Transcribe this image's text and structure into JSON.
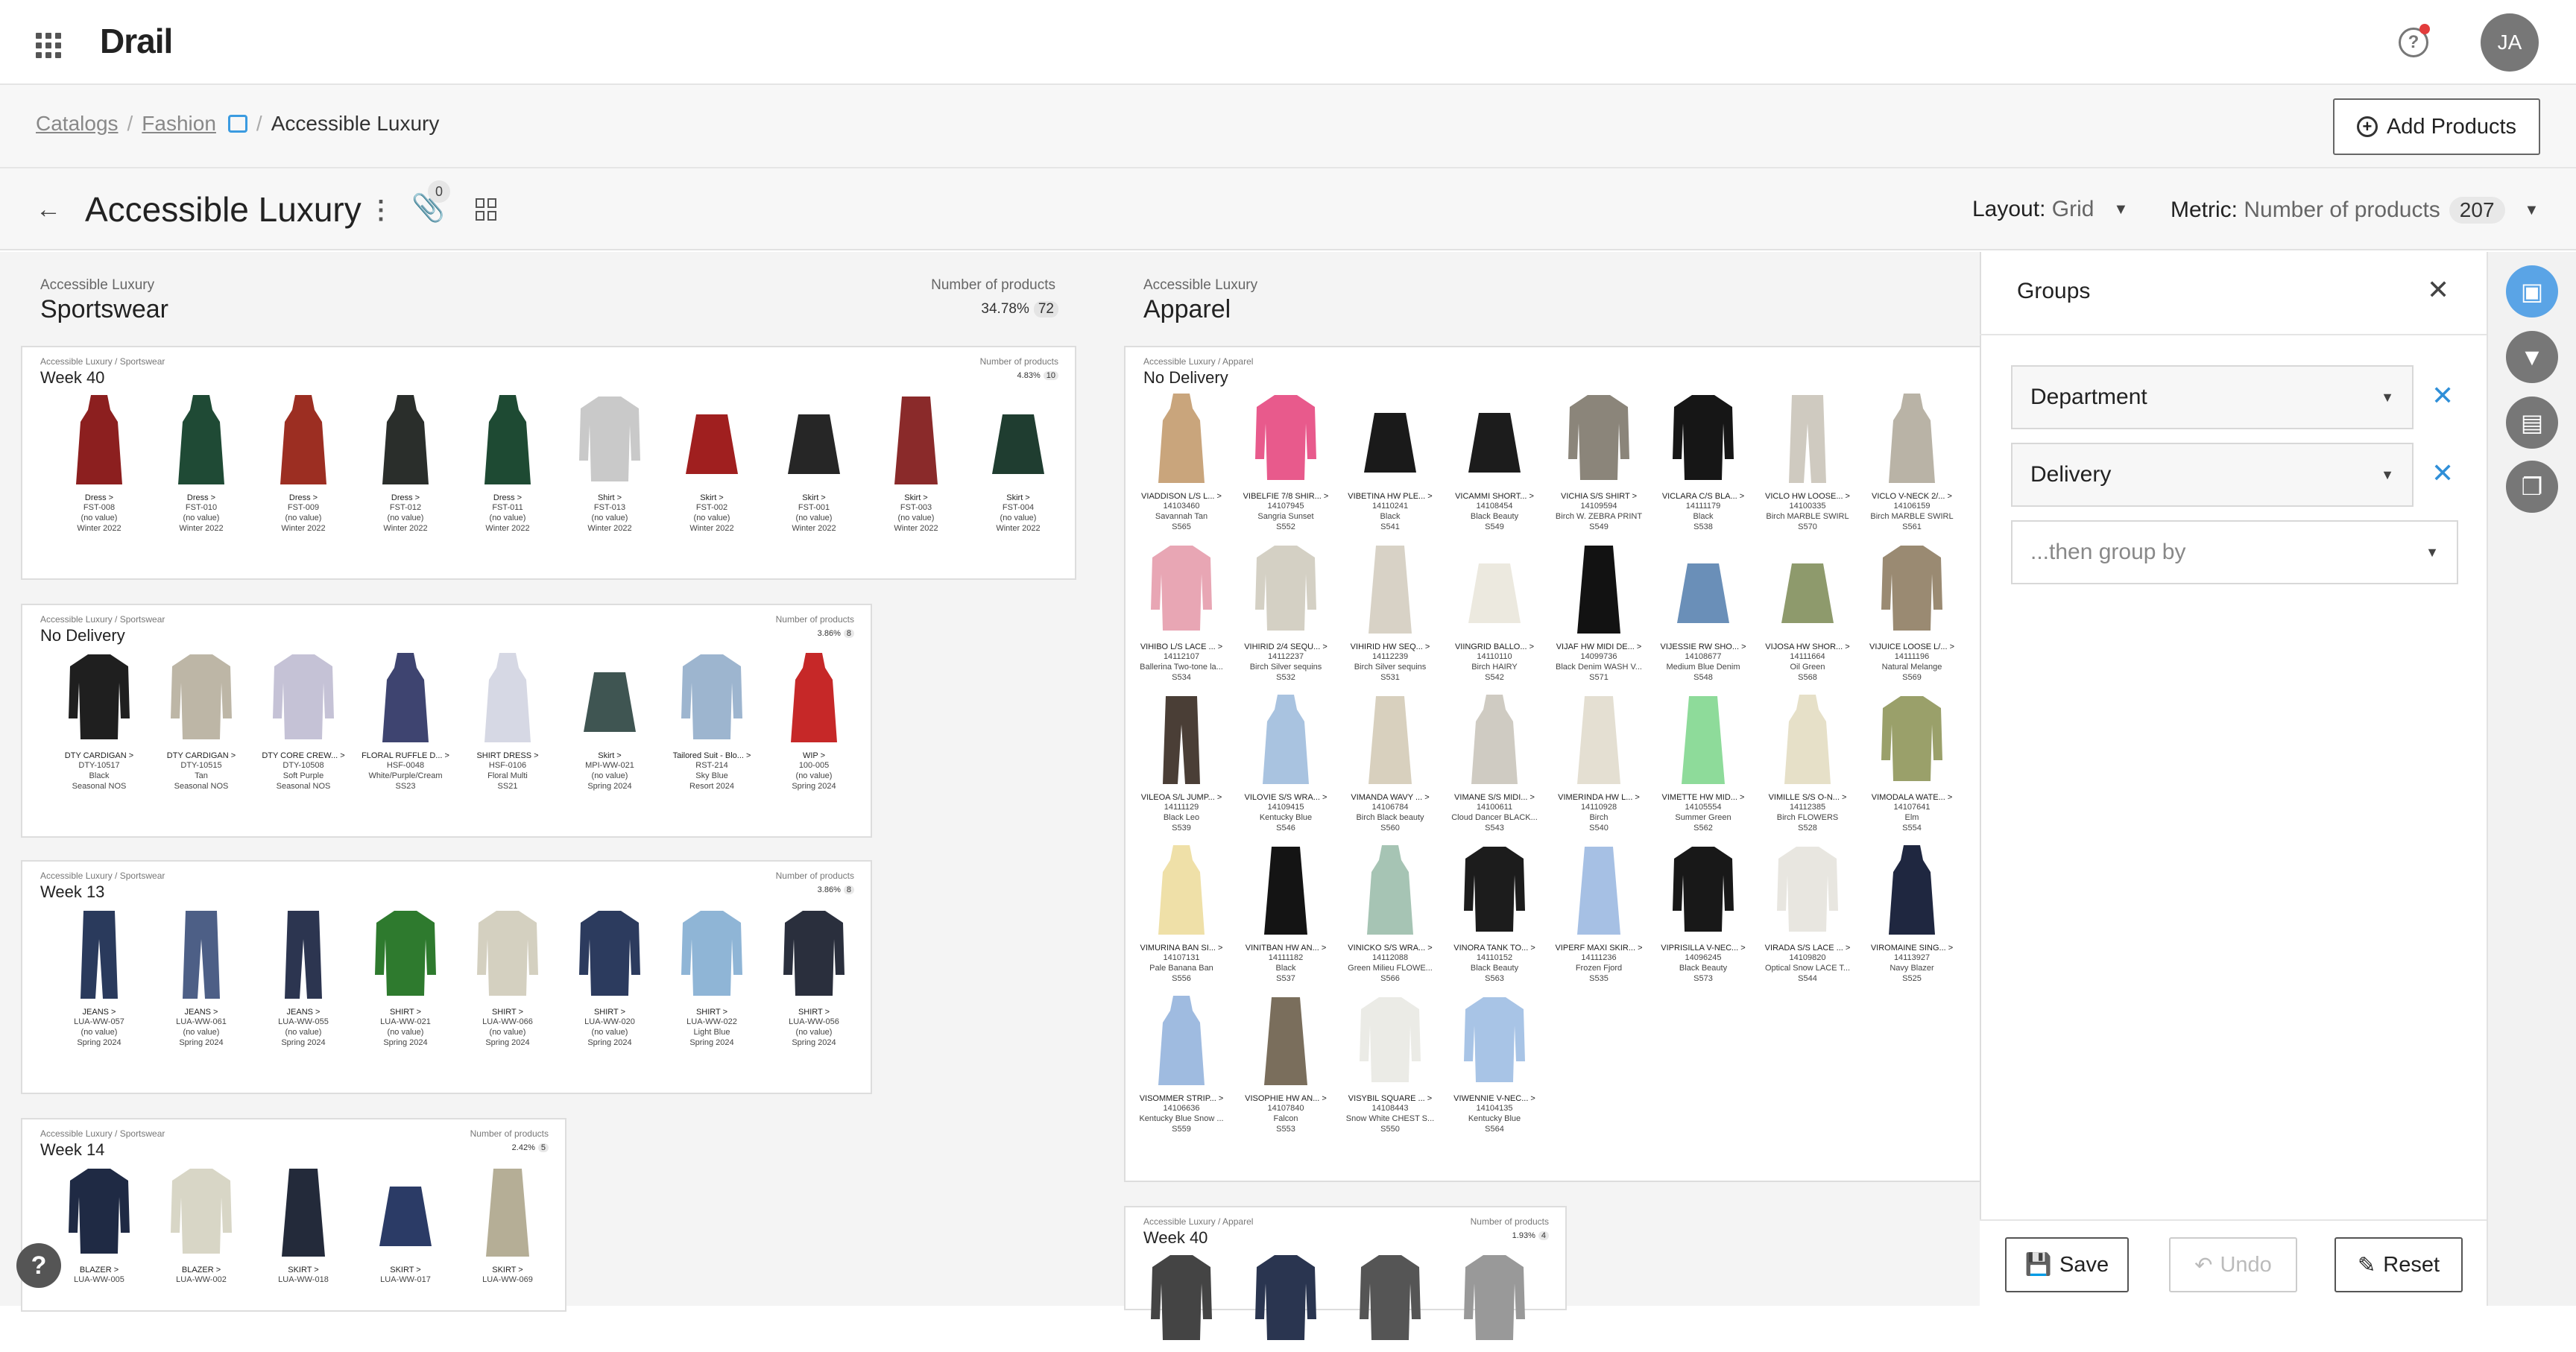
{
  "app": {
    "title": "Drail",
    "avatar": "JA",
    "help": "?"
  },
  "breadcrumb": {
    "items": [
      "Catalogs",
      "Fashion"
    ],
    "current": "Accessible Luxury",
    "sep": "/"
  },
  "header": {
    "add_products": "Add Products",
    "title": "Accessible Luxury",
    "clip_count": "0",
    "layout_label": "Layout:",
    "layout_value": "Grid",
    "metric_label": "Metric:",
    "metric_value": "Number of products",
    "metric_count": "207"
  },
  "sections": [
    {
      "sub": "Accessible Luxury",
      "title": "Sportswear",
      "metric_label": "Number of products",
      "pct": "34.78%",
      "count": "72"
    },
    {
      "sub": "Accessible Luxury",
      "title": "Apparel"
    }
  ],
  "cards": [
    {
      "sub": "Accessible Luxury / Sportswear",
      "title": "Week 40",
      "metric_label": "Number of products",
      "pct": "4.83%",
      "count": "10",
      "products": [
        {
          "name": "Dress >",
          "sku": "FST-008",
          "color": "(no value)",
          "season": "Winter 2022",
          "fill": "#8c1f1f",
          "shape": "dress"
        },
        {
          "name": "Dress >",
          "sku": "FST-010",
          "color": "(no value)",
          "season": "Winter 2022",
          "fill": "#1f4a35",
          "shape": "dress"
        },
        {
          "name": "Dress >",
          "sku": "FST-009",
          "color": "(no value)",
          "season": "Winter 2022",
          "fill": "#9c2e22",
          "shape": "dress"
        },
        {
          "name": "Dress >",
          "sku": "FST-012",
          "color": "(no value)",
          "season": "Winter 2022",
          "fill": "#2a2e2b",
          "shape": "dress"
        },
        {
          "name": "Dress >",
          "sku": "FST-011",
          "color": "(no value)",
          "season": "Winter 2022",
          "fill": "#1e4a33",
          "shape": "dress"
        },
        {
          "name": "Shirt >",
          "sku": "FST-013",
          "color": "(no value)",
          "season": "Winter 2022",
          "fill": "#c9c9c9",
          "shape": "top"
        },
        {
          "name": "Skirt >",
          "sku": "FST-002",
          "color": "(no value)",
          "season": "Winter 2022",
          "fill": "#a01f1f",
          "shape": "skirt"
        },
        {
          "name": "Skirt >",
          "sku": "FST-001",
          "color": "(no value)",
          "season": "Winter 2022",
          "fill": "#262626",
          "shape": "skirt"
        },
        {
          "name": "Skirt >",
          "sku": "FST-003",
          "color": "(no value)",
          "season": "Winter 2022",
          "fill": "#8a2a2a",
          "shape": "longskirt"
        },
        {
          "name": "Skirt >",
          "sku": "FST-004",
          "color": "(no value)",
          "season": "Winter 2022",
          "fill": "#1f3d30",
          "shape": "skirt"
        }
      ]
    },
    {
      "sub": "Accessible Luxury / Sportswear",
      "title": "No Delivery",
      "metric_label": "Number of products",
      "pct": "3.86%",
      "count": "8",
      "products": [
        {
          "name": "DTY CARDIGAN >",
          "sku": "DTY-10517",
          "color": "Black",
          "season": "Seasonal NOS",
          "fill": "#1f1f1f",
          "shape": "top"
        },
        {
          "name": "DTY CARDIGAN >",
          "sku": "DTY-10515",
          "color": "Tan",
          "season": "Seasonal NOS",
          "fill": "#bdb6a6",
          "shape": "top"
        },
        {
          "name": "DTY CORE CREW... >",
          "sku": "DTY-10508",
          "color": "Soft Purple",
          "season": "Seasonal NOS",
          "fill": "#c5c2d6",
          "shape": "top"
        },
        {
          "name": "FLORAL RUFFLE D... >",
          "sku": "HSF-0048",
          "color": "White/Purple/Cream",
          "season": "SS23",
          "fill": "#3e4470",
          "shape": "dress"
        },
        {
          "name": "SHIRT DRESS >",
          "sku": "HSF-0106",
          "color": "Floral Multi",
          "season": "SS21",
          "fill": "#d6d8e4",
          "shape": "dress"
        },
        {
          "name": "Skirt >",
          "sku": "MPI-WW-021",
          "color": "(no value)",
          "season": "Spring 2024",
          "fill": "#3f5552",
          "shape": "skirt"
        },
        {
          "name": "Tailored Suit - Blo... >",
          "sku": "RST-214",
          "color": "Sky Blue",
          "season": "Resort 2024",
          "fill": "#9db5cf",
          "shape": "top"
        },
        {
          "name": "WIP >",
          "sku": "100-005",
          "color": "(no value)",
          "season": "Spring 2024",
          "fill": "#c62828",
          "shape": "dress"
        }
      ]
    },
    {
      "sub": "Accessible Luxury / Sportswear",
      "title": "Week 13",
      "metric_label": "Number of products",
      "pct": "3.86%",
      "count": "8",
      "products": [
        {
          "name": "JEANS >",
          "sku": "LUA-WW-057",
          "color": "(no value)",
          "season": "Spring 2024",
          "fill": "#2a3a5c",
          "shape": "pants"
        },
        {
          "name": "JEANS >",
          "sku": "LUA-WW-061",
          "color": "(no value)",
          "season": "Spring 2024",
          "fill": "#4d5f86",
          "shape": "pants"
        },
        {
          "name": "JEANS >",
          "sku": "LUA-WW-055",
          "color": "(no value)",
          "season": "Spring 2024",
          "fill": "#2c3550",
          "shape": "pants"
        },
        {
          "name": "SHIRT >",
          "sku": "LUA-WW-021",
          "color": "(no value)",
          "season": "Spring 2024",
          "fill": "#2e7a2e",
          "shape": "top"
        },
        {
          "name": "SHIRT >",
          "sku": "LUA-WW-066",
          "color": "(no value)",
          "season": "Spring 2024",
          "fill": "#d4d0c0",
          "shape": "top"
        },
        {
          "name": "SHIRT >",
          "sku": "LUA-WW-020",
          "color": "(no value)",
          "season": "Spring 2024",
          "fill": "#2c3b5e",
          "shape": "top"
        },
        {
          "name": "SHIRT >",
          "sku": "LUA-WW-022",
          "color": "Light Blue",
          "season": "Spring 2024",
          "fill": "#8fb5d6",
          "shape": "top"
        },
        {
          "name": "SHIRT >",
          "sku": "LUA-WW-056",
          "color": "(no value)",
          "season": "Spring 2024",
          "fill": "#2a2f3d",
          "shape": "top"
        }
      ]
    },
    {
      "sub": "Accessible Luxury / Sportswear",
      "title": "Week 14",
      "metric_label": "Number of products",
      "pct": "2.42%",
      "count": "5",
      "products": [
        {
          "name": "BLAZER >",
          "sku": "LUA-WW-005",
          "color": "",
          "season": "",
          "fill": "#1f2a44",
          "shape": "top"
        },
        {
          "name": "BLAZER >",
          "sku": "LUA-WW-002",
          "color": "",
          "season": "",
          "fill": "#d8d6c6",
          "shape": "top"
        },
        {
          "name": "SKIRT >",
          "sku": "LUA-WW-018",
          "color": "",
          "season": "",
          "fill": "#232a3a",
          "shape": "longskirt"
        },
        {
          "name": "SKIRT >",
          "sku": "LUA-WW-017",
          "color": "",
          "season": "",
          "fill": "#2b3b66",
          "shape": "skirt"
        },
        {
          "name": "SKIRT >",
          "sku": "LUA-WW-069",
          "color": "",
          "season": "",
          "fill": "#b5ae96",
          "shape": "longskirt"
        }
      ]
    },
    {
      "sub": "Accessible Luxury / Apparel",
      "title": "No Delivery",
      "products": [
        {
          "name": "VIADDISON L/S L... >",
          "sku": "14103460",
          "color": "Savannah Tan",
          "season": "S565",
          "fill": "#c9a57c",
          "shape": "dress"
        },
        {
          "name": "VIBELFIE 7/8 SHIR... >",
          "sku": "14107945",
          "color": "Sangria Sunset",
          "season": "S552",
          "fill": "#e85a8c",
          "shape": "top"
        },
        {
          "name": "VIBETINA HW PLE... >",
          "sku": "14110241",
          "color": "Black",
          "season": "S541",
          "fill": "#1a1a1a",
          "shape": "skirt"
        },
        {
          "name": "VICAMMI SHORT... >",
          "sku": "14108454",
          "color": "Black Beauty",
          "season": "S549",
          "fill": "#1c1c1c",
          "shape": "skirt"
        },
        {
          "name": "VICHIA S/S SHIRT >",
          "sku": "14109594",
          "color": "Birch W. ZEBRA PRINT",
          "season": "S549",
          "fill": "#8b857a",
          "shape": "top"
        },
        {
          "name": "VICLARA C/S BLA... >",
          "sku": "14111179",
          "color": "Black",
          "season": "S538",
          "fill": "#161616",
          "shape": "top"
        },
        {
          "name": "VICLO HW LOOSE... >",
          "sku": "14100335",
          "color": "Birch MARBLE SWIRL",
          "season": "S570",
          "fill": "#cfcac0",
          "shape": "pants"
        },
        {
          "name": "VICLO V-NECK 2/... >",
          "sku": "14106159",
          "color": "Birch MARBLE SWIRL",
          "season": "S561",
          "fill": "#b9b3a6",
          "shape": "dress"
        },
        {
          "name": "VIHIBO L/S LACE ... >",
          "sku": "14112107",
          "color": "Ballerina Two-tone la...",
          "season": "S534",
          "fill": "#e8a6b4",
          "shape": "top"
        },
        {
          "name": "VIHIRID 2/4 SEQU... >",
          "sku": "14112237",
          "color": "Birch Silver sequins",
          "season": "S532",
          "fill": "#d4d0c4",
          "shape": "top"
        },
        {
          "name": "VIHIRID HW SEQ... >",
          "sku": "14112239",
          "color": "Birch Silver sequins",
          "season": "S531",
          "fill": "#d8d2c6",
          "shape": "longskirt"
        },
        {
          "name": "VIINGRID BALLO... >",
          "sku": "14110110",
          "color": "Birch HAIRY",
          "season": "S542",
          "fill": "#ece9df",
          "shape": "skirt"
        },
        {
          "name": "VIJAF HW MIDI DE... >",
          "sku": "14099736",
          "color": "Black Denim WASH V...",
          "season": "S571",
          "fill": "#121212",
          "shape": "longskirt"
        },
        {
          "name": "VIJESSIE RW SHO... >",
          "sku": "14108677",
          "color": "Medium Blue Denim",
          "season": "S548",
          "fill": "#6a8fb8",
          "shape": "skirt"
        },
        {
          "name": "VIJOSA HW SHOR... >",
          "sku": "14111664",
          "color": "Oil Green",
          "season": "S568",
          "fill": "#8e9a6c",
          "shape": "skirt"
        },
        {
          "name": "VIJUICE LOOSE L/... >",
          "sku": "14111196",
          "color": "Natural Melange",
          "season": "S569",
          "fill": "#9a8a72",
          "shape": "top"
        },
        {
          "name": "VILEOA S/L JUMP... >",
          "sku": "14111129",
          "color": "Black Leo",
          "season": "S539",
          "fill": "#4a3e36",
          "shape": "pants"
        },
        {
          "name": "VILOVIE S/S WRA... >",
          "sku": "14109415",
          "color": "Kentucky Blue",
          "season": "S546",
          "fill": "#a9c3e0",
          "shape": "dress"
        },
        {
          "name": "VIMANDA WAVY ... >",
          "sku": "14106784",
          "color": "Birch Black beauty",
          "season": "S560",
          "fill": "#d8d0be",
          "shape": "longskirt"
        },
        {
          "name": "VIMANE S/S MIDI... >",
          "sku": "14100611",
          "color": "Cloud Dancer BLACK...",
          "season": "S543",
          "fill": "#cfcbc2",
          "shape": "dress"
        },
        {
          "name": "VIMERINDA HW L... >",
          "sku": "14110928",
          "color": "Birch",
          "season": "S540",
          "fill": "#e4dfd2",
          "shape": "longskirt"
        },
        {
          "name": "VIMETTE HW MID... >",
          "sku": "14105554",
          "color": "Summer Green",
          "season": "S562",
          "fill": "#8edb9a",
          "shape": "longskirt"
        },
        {
          "name": "VIMILLE S/S O-N... >",
          "sku": "14112385",
          "color": "Birch FLOWERS",
          "season": "S528",
          "fill": "#e6e0c8",
          "shape": "dress"
        },
        {
          "name": "VIMODALA WATE... >",
          "sku": "14107641",
          "color": "Elm",
          "season": "S554",
          "fill": "#9aa06a",
          "shape": "top"
        },
        {
          "name": "VIMURINA BAN SI... >",
          "sku": "14107131",
          "color": "Pale Banana Ban",
          "season": "S556",
          "fill": "#efe0a8",
          "shape": "dress"
        },
        {
          "name": "VINITBAN HW AN... >",
          "sku": "14111182",
          "color": "Black",
          "season": "S537",
          "fill": "#141414",
          "shape": "longskirt"
        },
        {
          "name": "VINICKO S/S WRA... >",
          "sku": "14112088",
          "color": "Green Milieu FLOWE...",
          "season": "S566",
          "fill": "#a6c4b4",
          "shape": "dress"
        },
        {
          "name": "VINORA TANK TO... >",
          "sku": "14110152",
          "color": "Black Beauty",
          "season": "S563",
          "fill": "#1c1c1c",
          "shape": "top"
        },
        {
          "name": "VIPERF MAXI SKIR... >",
          "sku": "14111236",
          "color": "Frozen Fjord",
          "season": "S535",
          "fill": "#a6c0e4",
          "shape": "longskirt"
        },
        {
          "name": "VIPRISILLA V-NEC... >",
          "sku": "14096245",
          "color": "Black Beauty",
          "season": "S573",
          "fill": "#181818",
          "shape": "top"
        },
        {
          "name": "VIRADA S/S LACE ... >",
          "sku": "14109820",
          "color": "Optical Snow LACE T...",
          "season": "S544",
          "fill": "#e8e6e0",
          "shape": "top"
        },
        {
          "name": "VIROMAINE SING... >",
          "sku": "14113927",
          "color": "Navy Blazer",
          "season": "S525",
          "fill": "#1f2740",
          "shape": "dress"
        },
        {
          "name": "VISOMMER STRIP... >",
          "sku": "14106636",
          "color": "Kentucky Blue Snow ...",
          "season": "S559",
          "fill": "#9fbbe0",
          "shape": "dress"
        },
        {
          "name": "VISOPHIE HW AN... >",
          "sku": "14107840",
          "color": "Falcon",
          "season": "S553",
          "fill": "#7a6e5c",
          "shape": "longskirt"
        },
        {
          "name": "VISYBIL SQUARE ... >",
          "sku": "14108443",
          "color": "Snow White CHEST S...",
          "season": "S550",
          "fill": "#ebebe6",
          "shape": "top"
        },
        {
          "name": "VIWENNIE V-NEC... >",
          "sku": "14104135",
          "color": "Kentucky Blue",
          "season": "S564",
          "fill": "#a8c4e6",
          "shape": "top"
        }
      ]
    },
    {
      "sub": "Accessible Luxury / Apparel",
      "title": "Week 40",
      "metric_label": "Number of products",
      "pct": "1.93%",
      "count": "4",
      "products": [
        {
          "name": "",
          "sku": "",
          "color": "",
          "season": "",
          "fill": "#444",
          "shape": "top"
        },
        {
          "name": "",
          "sku": "",
          "color": "",
          "season": "",
          "fill": "#2a3550",
          "shape": "top"
        },
        {
          "name": "",
          "sku": "",
          "color": "",
          "season": "",
          "fill": "#555",
          "shape": "top"
        },
        {
          "name": "",
          "sku": "",
          "color": "",
          "season": "",
          "fill": "#999",
          "shape": "top"
        }
      ]
    }
  ],
  "groups_panel": {
    "title": "Groups",
    "selects": [
      "Department",
      "Delivery"
    ],
    "placeholder": "...then group by",
    "save": "Save",
    "undo": "Undo",
    "reset": "Reset"
  },
  "colors": {
    "accent": "#2f8fd8",
    "rail_active": "#5aa4e6"
  }
}
